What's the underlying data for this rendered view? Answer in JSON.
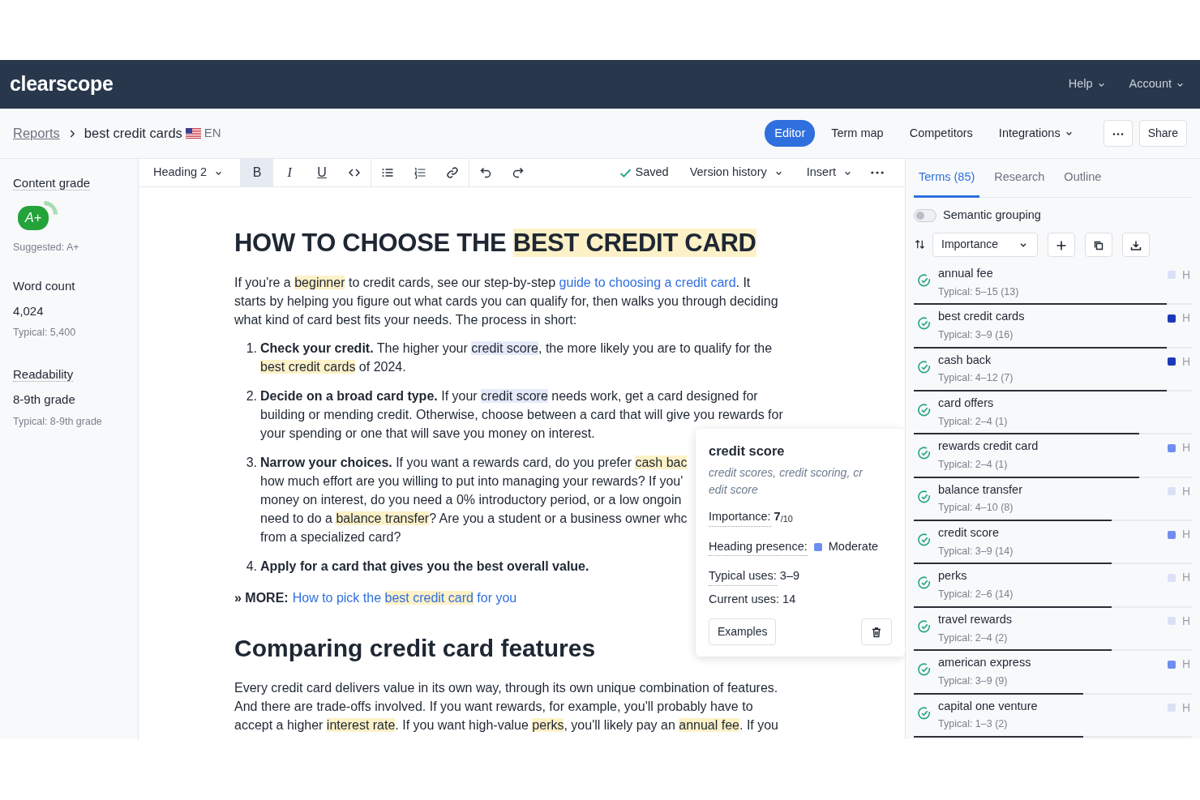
{
  "app": {
    "logo": "clearscope",
    "menus": [
      {
        "label": "Help"
      },
      {
        "label": "Account"
      }
    ]
  },
  "breadcrumb": {
    "root": "Reports",
    "current": "best credit cards",
    "language": "EN"
  },
  "view_tabs": [
    {
      "label": "Editor",
      "selected": true,
      "dropdown": false
    },
    {
      "label": "Term map",
      "selected": false,
      "dropdown": false
    },
    {
      "label": "Competitors",
      "selected": false,
      "dropdown": false
    },
    {
      "label": "Integrations",
      "selected": false,
      "dropdown": true
    }
  ],
  "share_button": "Share",
  "metrics": [
    {
      "kind": "grade",
      "label": "Content grade",
      "tooltip": true,
      "value": "A+",
      "note": "Suggested: A+"
    },
    {
      "kind": "stat",
      "label": "Word count",
      "tooltip": false,
      "value": "4,024",
      "note": "Typical: 5,400"
    },
    {
      "kind": "stat",
      "label": "Readability",
      "tooltip": true,
      "value": "8-9th grade",
      "note": "Typical: 8-9th grade"
    }
  ],
  "toolbar": {
    "block_style": "Heading 2",
    "format_buttons": [
      {
        "label": "B",
        "selected": true
      },
      {
        "label": "I",
        "selected": false
      },
      {
        "label": "U",
        "selected": false
      }
    ],
    "save_status": "Saved",
    "version_history": "Version history",
    "insert": "Insert"
  },
  "document": [
    {
      "kind": "h1",
      "lines": [
        [
          {
            "text": "HOW TO CHOOSE THE "
          },
          {
            "text": "BEST CREDIT CARD",
            "kind": "term"
          }
        ]
      ]
    },
    {
      "kind": "p",
      "lines": [
        [
          {
            "text": "If you're a "
          },
          {
            "text": "beginner",
            "kind": "term"
          },
          {
            "text": " to credit cards, see our step-by-step "
          },
          {
            "text": "guide to choosing a credit card",
            "kind": "link"
          },
          {
            "text": ". It"
          }
        ],
        [
          {
            "text": "starts by helping you figure out what cards you can qualify for, then walks you through deciding"
          }
        ],
        [
          {
            "text": "what kind of card best fits your needs. The process in short:"
          }
        ]
      ]
    },
    {
      "kind": "item",
      "number": "1.",
      "lines": [
        [
          {
            "text": "Check your credit.",
            "kind": "bold"
          },
          {
            "text": " The higher your "
          },
          {
            "text": "credit score",
            "kind": "focus"
          },
          {
            "text": ", the more likely you are to qualify for the"
          }
        ],
        [
          {
            "text": "best credit cards",
            "kind": "term"
          },
          {
            "text": " of 2024."
          }
        ]
      ]
    },
    {
      "kind": "item",
      "number": "2.",
      "lines": [
        [
          {
            "text": "Decide on a broad card type.",
            "kind": "bold"
          },
          {
            "text": " If your "
          },
          {
            "text": "credit score",
            "kind": "focus"
          },
          {
            "text": " needs work, get a card designed for"
          }
        ],
        [
          {
            "text": "building or mending credit. Otherwise, choose between a card that will give you rewards for"
          }
        ],
        [
          {
            "text": "your spending or one that will save you money on interest."
          }
        ]
      ]
    },
    {
      "kind": "item",
      "number": "3.",
      "lines": [
        [
          {
            "text": "Narrow your choices.",
            "kind": "bold"
          },
          {
            "text": " If you want a rewards card, do you prefer "
          },
          {
            "text": "cash bac",
            "kind": "term"
          }
        ],
        [
          {
            "text": "how much effort are you willing to put into managing your rewards? If you'"
          }
        ],
        [
          {
            "text": "money on interest, do you need a 0% introductory period, or a low ongoin"
          }
        ],
        [
          {
            "text": "need to do a "
          },
          {
            "text": "balance transfer",
            "kind": "term"
          },
          {
            "text": "? Are you a student or a business owner whc"
          }
        ],
        [
          {
            "text": "from a specialized card?"
          }
        ]
      ]
    },
    {
      "kind": "item",
      "number": "4.",
      "lines": [
        [
          {
            "text": "Apply for a card that gives you the best overall value.",
            "kind": "bold"
          }
        ]
      ]
    },
    {
      "kind": "more",
      "lines": [
        [
          {
            "text": "» MORE:",
            "kind": "bold"
          },
          {
            "kind": "link",
            "parts": [
              {
                "text": "How to pick the "
              },
              {
                "text": "best credit card",
                "kind": "term"
              },
              {
                "text": " for you"
              }
            ]
          }
        ]
      ]
    },
    {
      "kind": "h2",
      "lines": [
        [
          {
            "text": "Comparing credit card features"
          }
        ]
      ]
    },
    {
      "kind": "p",
      "lines": [
        [
          {
            "text": "Every credit card delivers value in its own way, through its own unique combination of features."
          }
        ],
        [
          {
            "text": "And there are trade-offs involved. If you want rewards, for example, you'll probably have to"
          }
        ],
        [
          {
            "text": "accept a higher "
          },
          {
            "text": "interest rate",
            "kind": "term"
          },
          {
            "text": ". If you want high-value "
          },
          {
            "text": "perks",
            "kind": "term"
          },
          {
            "text": ", you'll likely pay an "
          },
          {
            "text": "annual fee",
            "kind": "term"
          },
          {
            "text": ". If you"
          }
        ]
      ]
    }
  ],
  "popover": {
    "term": "credit score",
    "variants": [
      "credit scores, credit scoring, cr",
      "edit score"
    ],
    "importance_label": "Importance:",
    "importance": "**7**$_{/10}$",
    "heading_label": "Heading presence:",
    "heading": {
      "color": "#6f8ef0",
      "value": "Moderate"
    },
    "typical_label": "Typical uses:",
    "typical_value": "3–9",
    "current": "Current uses: 14",
    "examples_button": "Examples"
  },
  "panel_tabs": [
    {
      "label": "Terms (85)",
      "selected": true
    },
    {
      "label": "Research",
      "selected": false
    },
    {
      "label": "Outline",
      "selected": false
    }
  ],
  "semantic_grouping": {
    "label": "Semantic grouping",
    "on": false
  },
  "sort": {
    "label": "Importance"
  },
  "terms": [
    {
      "name": "annual fee",
      "typical": "Typical: 5–15 (13)",
      "checked": true,
      "color": "#dbe0f7",
      "heading_label": "H",
      "level": 0.91
    },
    {
      "name": "best credit cards",
      "typical": "Typical: 3–9 (16)",
      "checked": true,
      "color": "#1a3ab8",
      "heading_label": "H",
      "level": 0.91
    },
    {
      "name": "cash back",
      "typical": "Typical: 4–12 (7)",
      "checked": true,
      "color": "#1a3ab8",
      "heading_label": "H",
      "level": 0.91
    },
    {
      "name": "card offers",
      "typical": "Typical: 2–4 (1)",
      "checked": true,
      "level": 0.81
    },
    {
      "name": "rewards credit card",
      "typical": "Typical: 2–4 (1)",
      "checked": true,
      "color": "#6f8ef0",
      "heading_label": "H",
      "level": 0.81
    },
    {
      "name": "balance transfer",
      "typical": "Typical: 4–10 (8)",
      "checked": true,
      "color": "#dbe0f7",
      "heading_label": "H",
      "level": 0.71
    },
    {
      "name": "credit score",
      "typical": "Typical: 3–9 (14)",
      "checked": true,
      "color": "#6f8ef0",
      "heading_label": "H",
      "level": 0.71
    },
    {
      "name": "perks",
      "typical": "Typical: 2–6 (14)",
      "checked": true,
      "color": "#dbe0f7",
      "heading_label": "H",
      "level": 0.71
    },
    {
      "name": "travel rewards",
      "typical": "Typical: 2–4 (2)",
      "checked": true,
      "color": "#dbe0f7",
      "heading_label": "H",
      "level": 0.71
    },
    {
      "name": "american express",
      "typical": "Typical: 3–9 (9)",
      "checked": true,
      "color": "#6f8ef0",
      "heading_label": "H",
      "level": 0.61
    },
    {
      "name": "capital one venture",
      "typical": "Typical: 1–3 (2)",
      "checked": true,
      "color": "#dbe0f7",
      "heading_label": "H",
      "level": 0.61
    }
  ]
}
